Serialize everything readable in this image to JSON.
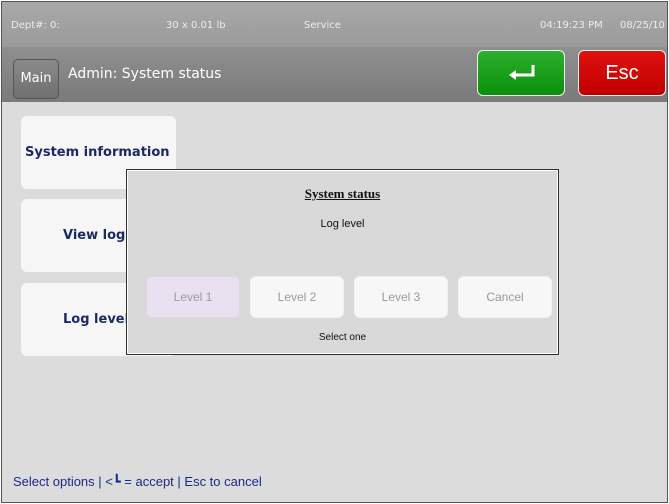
{
  "status_bar": {
    "dept": "Dept#: 0:",
    "scale": "30 x 0.01 lb",
    "mode": "Service",
    "time": "04:19:23 PM",
    "date": "08/25/10"
  },
  "title_bar": {
    "main_label": "Main",
    "title": "Admin: System status",
    "enter_icon": "enter-arrow-icon",
    "esc_label": "Esc"
  },
  "menu": {
    "items": [
      {
        "label": "System information"
      },
      {
        "label": "View logs"
      },
      {
        "label": "Log level"
      }
    ]
  },
  "dialog": {
    "title": "System status",
    "subtitle": "Log level",
    "options": [
      {
        "label": "Level 1",
        "selected": true
      },
      {
        "label": "Level 2",
        "selected": false
      },
      {
        "label": "Level 3",
        "selected": false
      },
      {
        "label": "Cancel",
        "selected": false
      }
    ],
    "hint": "Select one"
  },
  "footer": {
    "hint": "Select options | <┗ = accept | Esc to cancel"
  },
  "colors": {
    "accept_green": "#0a8f0a",
    "cancel_red": "#c00000",
    "selected_option": "#e9e1f0"
  }
}
